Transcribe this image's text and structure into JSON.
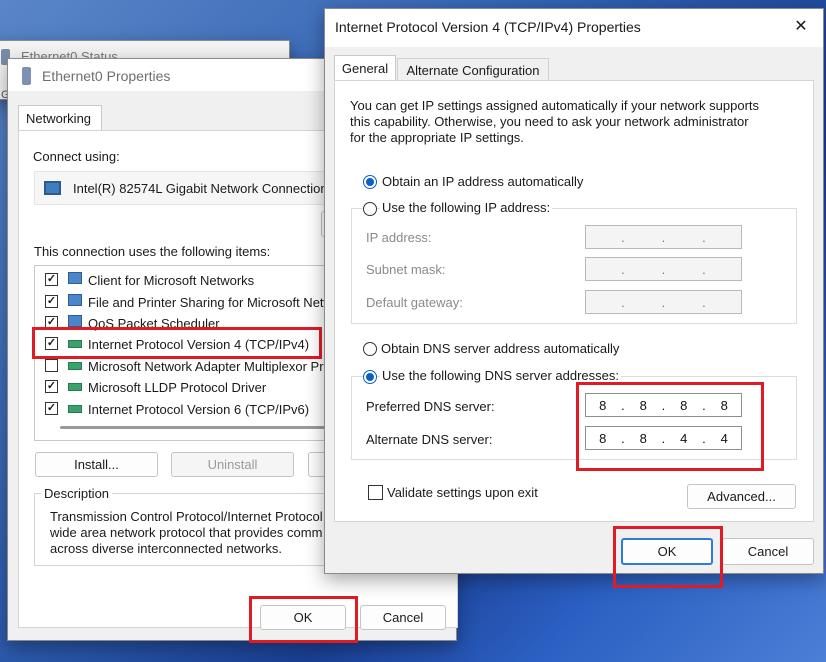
{
  "status_window": {
    "title": "Ethernet0 Status",
    "side_char": "G"
  },
  "eth_props": {
    "title": "Ethernet0 Properties",
    "tab": "Networking",
    "connect_using_label": "Connect using:",
    "adapter_name": "Intel(R) 82574L Gigabit Network Connection",
    "items_label": "This connection uses the following items:",
    "items": [
      {
        "label": "Client for Microsoft Networks",
        "checked": true
      },
      {
        "label": "File and Printer Sharing for Microsoft Networks",
        "checked": true
      },
      {
        "label": "QoS Packet Scheduler",
        "checked": true
      },
      {
        "label": "Internet Protocol Version 4 (TCP/IPv4)",
        "checked": true
      },
      {
        "label": "Microsoft Network Adapter Multiplexor Protocol",
        "checked": false
      },
      {
        "label": "Microsoft LLDP Protocol Driver",
        "checked": true
      },
      {
        "label": "Internet Protocol Version 6 (TCP/IPv6)",
        "checked": true
      }
    ],
    "install_label": "Install...",
    "uninstall_label": "Uninstall",
    "description_label": "Description",
    "description_lines": [
      "Transmission Control Protocol/Internet Protocol",
      "wide area network protocol that provides comm",
      "across diverse interconnected networks."
    ],
    "ok_label": "OK",
    "cancel_label": "Cancel"
  },
  "ipv4": {
    "title": "Internet Protocol Version 4 (TCP/IPv4) Properties",
    "close_glyph": "✕",
    "tabs": [
      "General",
      "Alternate Configuration"
    ],
    "intro_lines": [
      "You can get IP settings assigned automatically if your network supports",
      "this capability. Otherwise, you need to ask your network administrator",
      "for the appropriate IP settings."
    ],
    "obtain_ip_auto": "Obtain an IP address automatically",
    "use_following_ip": "Use the following IP address:",
    "ip_address_label": "IP address:",
    "subnet_mask_label": "Subnet mask:",
    "default_gateway_label": "Default gateway:",
    "ip_dots": [
      ".",
      ".",
      "."
    ],
    "obtain_dns_auto": "Obtain DNS server address automatically",
    "use_following_dns": "Use the following DNS server addresses:",
    "preferred_dns_label": "Preferred DNS server:",
    "alternate_dns_label": "Alternate DNS server:",
    "preferred_dns": [
      "8",
      "8",
      "8",
      "8"
    ],
    "alternate_dns": [
      "8",
      "8",
      "4",
      "4"
    ],
    "validate_label": "Validate settings upon exit",
    "advanced_label": "Advanced...",
    "ok_label": "OK",
    "cancel_label": "Cancel"
  },
  "colors": {
    "highlight_red": "#e01b24",
    "accent_blue": "#0c5fc9"
  }
}
